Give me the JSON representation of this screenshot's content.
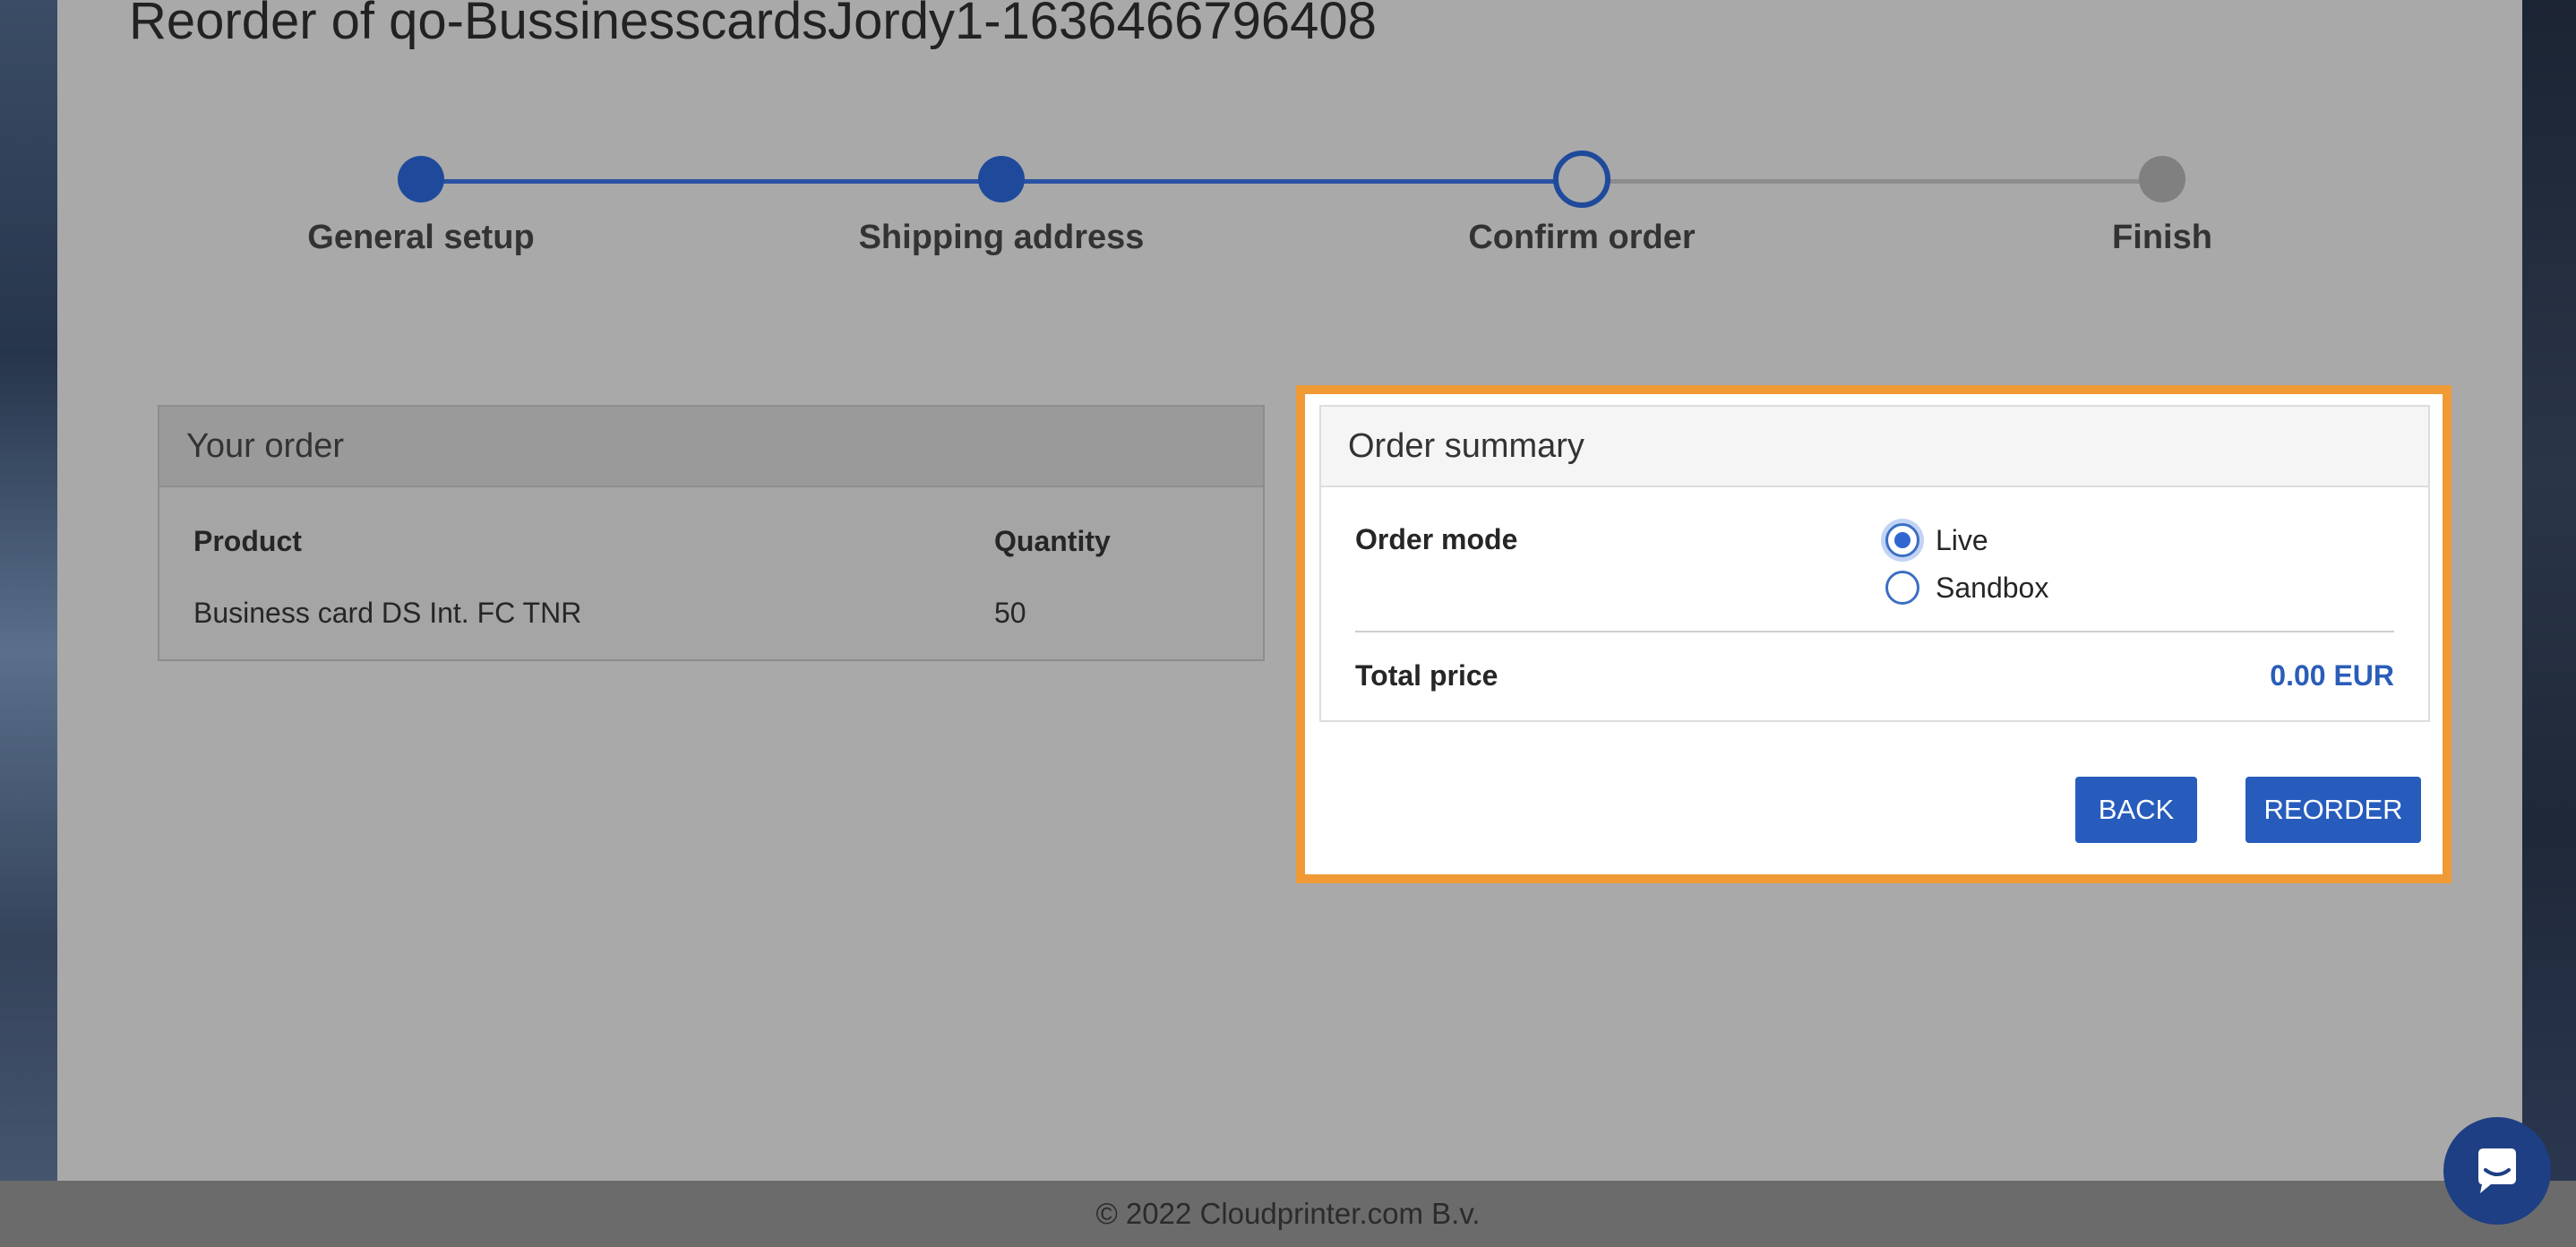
{
  "page": {
    "title": "Reorder of qo-BussinesscardsJordy1-1636466796408"
  },
  "stepper": {
    "steps": [
      {
        "label": "General setup",
        "state": "done"
      },
      {
        "label": "Shipping address",
        "state": "done"
      },
      {
        "label": "Confirm order",
        "state": "current"
      },
      {
        "label": "Finish",
        "state": "todo"
      }
    ]
  },
  "your_order": {
    "title": "Your order",
    "columns": [
      "Product",
      "Quantity"
    ],
    "rows": [
      {
        "product": "Business card DS Int. FC TNR",
        "quantity": "50"
      }
    ]
  },
  "summary": {
    "title": "Order summary",
    "order_mode_label": "Order mode",
    "options": [
      {
        "label": "Live",
        "checked": true
      },
      {
        "label": "Sandbox",
        "checked": false
      }
    ],
    "total_label": "Total price",
    "total_value": "0.00 EUR",
    "back_label": "BACK",
    "reorder_label": "REORDER",
    "highlight_color": "#f09a35"
  },
  "footer": {
    "text": "© 2022 Cloudprinter.com B.v."
  },
  "chat": {
    "icon": "chat-bubble-icon"
  },
  "colors": {
    "primary": "#275cbd",
    "step_done": "#1f4a9c",
    "overlay_gray": "#a9a9a9"
  }
}
